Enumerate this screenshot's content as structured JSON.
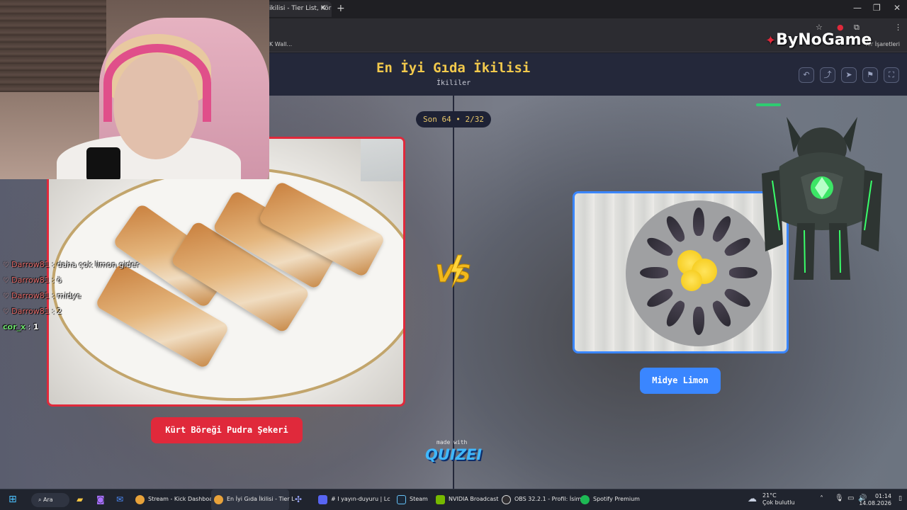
{
  "browser": {
    "tab_title": "ikilisi - Tier List, Kör",
    "tab_close": "✕",
    "new_tab": "+",
    "win_min": "—",
    "win_max": "❐",
    "win_close": "✕",
    "bookmark_left": "K Wall...",
    "bookmark_right": "Yer İşaretleri"
  },
  "quiz": {
    "title": "En İyi Gıda İkilisi",
    "subtitle": "İkililer",
    "progress": "Son 64 • 2/32",
    "left_option": "Kürt Böreği Pudra Şekeri",
    "right_option": "Midye Limon",
    "made_with": "made with",
    "brand": "QUIZEI",
    "header_buttons": [
      "↶",
      "⤴",
      "➤",
      "⚑",
      "⛶"
    ]
  },
  "watermark": {
    "text": "ByNoGame"
  },
  "chat": [
    {
      "user": "Darrow81",
      "sep": " : ",
      "msg": "daha çok limon gider",
      "heart": true
    },
    {
      "user": "Darrow81",
      "sep": " : ",
      "msg": "ö",
      "heart": true
    },
    {
      "user": "Darrow81",
      "sep": " : ",
      "msg": "midye",
      "heart": true
    },
    {
      "user": "Darrow81",
      "sep": " : ",
      "msg": "2",
      "heart": true
    },
    {
      "user": "cor_x",
      "sep": " : ",
      "msg": "1",
      "heart": false
    }
  ],
  "taskbar": {
    "search": "Ara",
    "apps": [
      "Stream - Kick Dashboar",
      "En İyi Gıda İkilisi - Tier L",
      "# I yayın-duyuru | Lc",
      "Steam",
      "NVIDIA Broadcast",
      "OBS 32.2.1 - Profil: İsims",
      "Spotify Premium"
    ],
    "weather_temp": "21°C",
    "weather_desc": "Çok bulutlu",
    "time": "01:14",
    "date": "14.08.2026"
  },
  "colors": {
    "accent_red": "#e0293b",
    "accent_blue": "#3a86ff",
    "title_yellow": "#f2c94c",
    "chat_green": "#6cde6c"
  }
}
